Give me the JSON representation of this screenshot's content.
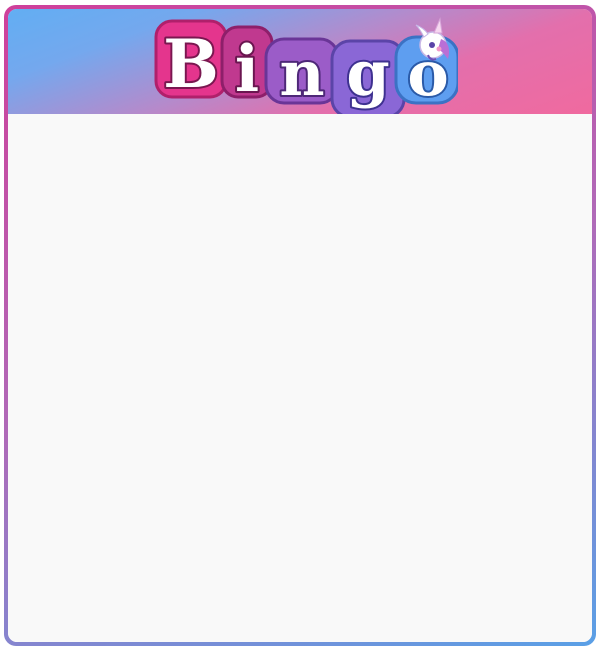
{
  "header": {
    "logo_letters": [
      "B",
      "i",
      "n",
      "g",
      "o"
    ],
    "logo_icon": "unicorn-icon"
  },
  "colors": {
    "pink": "#e4358d",
    "magenta": "#c0398f",
    "purple": "#8a67d6",
    "blue": "#5e9ef0",
    "letter_fill": "#ffffff",
    "board_bg": "#f9f9f9"
  }
}
